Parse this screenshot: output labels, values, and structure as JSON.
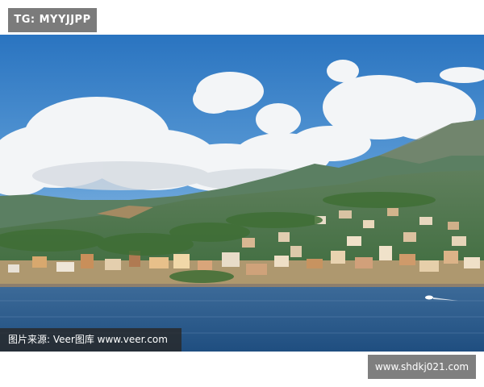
{
  "tag_label": "TG: MYYJJPP",
  "credit_text": "图片来源:  Veer图库 www.veer.com",
  "site_label": "www.shdkj021.com",
  "colors": {
    "sky_top": "#2f7cc6",
    "sky_bottom": "#8fbde6",
    "cloud": "#f4f6f8",
    "mountain": "#4f7a4e",
    "sea": "#2f5f8e",
    "town": "#d8b48a"
  }
}
